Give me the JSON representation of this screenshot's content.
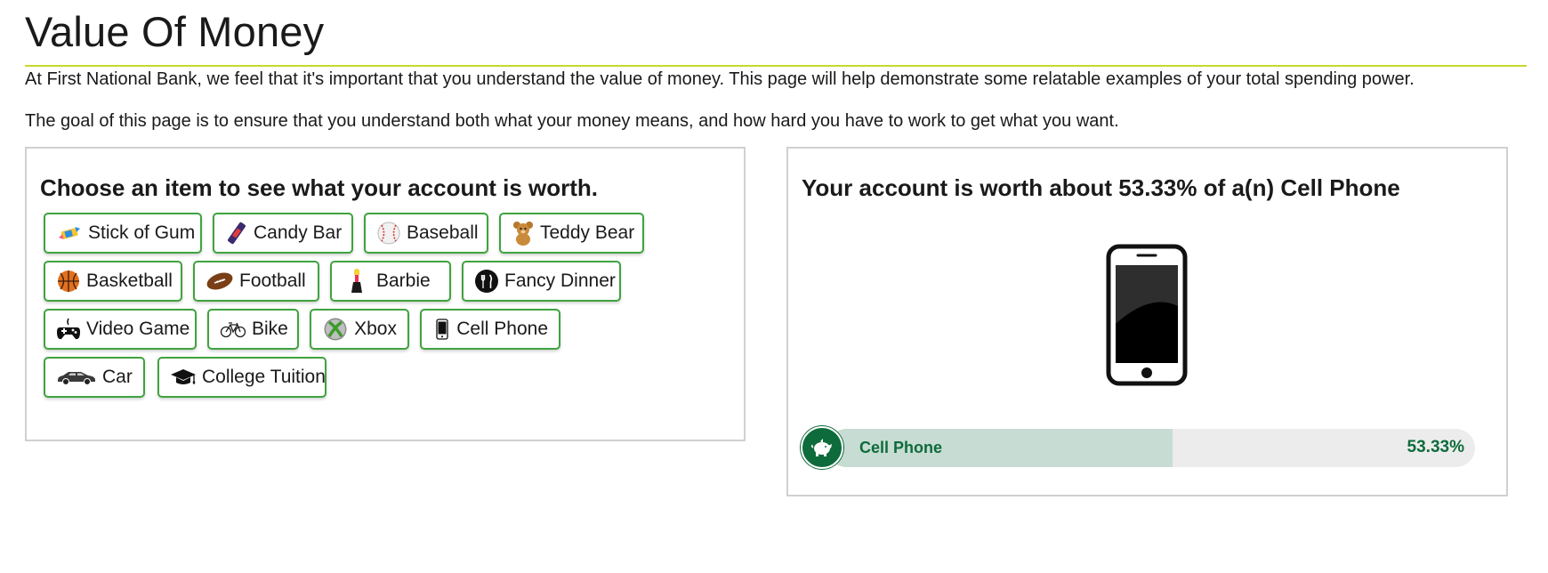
{
  "page": {
    "title": "Value Of Money",
    "intro_1": "At First National Bank, we feel that it's important that you understand the value of money. This page will help demonstrate some relatable examples of your total spending power.",
    "intro_2": "The goal of this page is to ensure that you understand both what your money means, and how hard you have to work to get what you want."
  },
  "chooser": {
    "heading": "Choose an item to see what your account is worth.",
    "items": [
      {
        "label": "Stick of Gum",
        "icon": "gum-icon"
      },
      {
        "label": "Candy Bar",
        "icon": "candy-bar-icon"
      },
      {
        "label": "Baseball",
        "icon": "baseball-icon"
      },
      {
        "label": "Teddy Bear",
        "icon": "teddy-bear-icon"
      },
      {
        "label": "Basketball",
        "icon": "basketball-icon"
      },
      {
        "label": "Football",
        "icon": "football-icon"
      },
      {
        "label": "Barbie",
        "icon": "barbie-icon"
      },
      {
        "label": "Fancy Dinner",
        "icon": "dinner-icon"
      },
      {
        "label": "Video Game",
        "icon": "gamepad-icon"
      },
      {
        "label": "Bike",
        "icon": "bike-icon"
      },
      {
        "label": "Xbox",
        "icon": "xbox-icon"
      },
      {
        "label": "Cell Phone",
        "icon": "cell-phone-icon"
      },
      {
        "label": "Car",
        "icon": "car-icon"
      },
      {
        "label": "College Tuition",
        "icon": "graduation-cap-icon"
      }
    ]
  },
  "result": {
    "heading": "Your account is worth about 53.33% of a(n) Cell Phone",
    "selected_item": "Cell Phone",
    "illustration": "smartphone-icon",
    "progress": {
      "label": "Cell Phone",
      "value_text": "53.33%",
      "fraction": 0.5333,
      "icon": "piggy-bank-icon"
    }
  },
  "colors": {
    "accent_rule": "#c7d82b",
    "button_border": "#3fa33f",
    "brand_green": "#0e6b3b",
    "progress_fill": "#c7dcd3",
    "progress_track": "#ececec"
  }
}
